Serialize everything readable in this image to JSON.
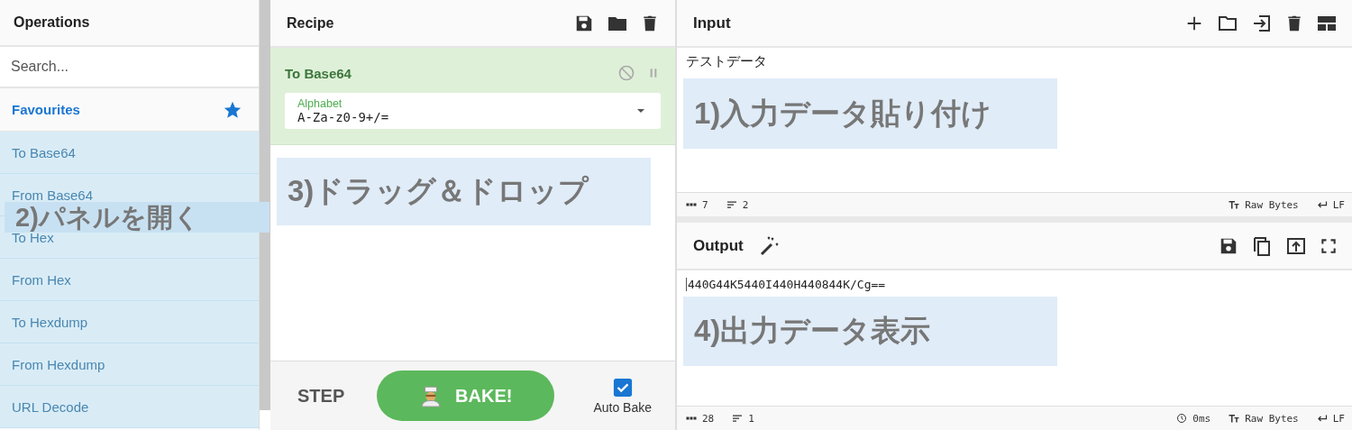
{
  "operations": {
    "title": "Operations",
    "search": {
      "placeholder": "Search..."
    },
    "favourites": {
      "label": "Favourites"
    },
    "items": [
      {
        "label": "To Base64"
      },
      {
        "label": "From Base64"
      },
      {
        "label": "To Hex"
      },
      {
        "label": "From Hex"
      },
      {
        "label": "To Hexdump"
      },
      {
        "label": "From Hexdump"
      },
      {
        "label": "URL Decode"
      }
    ]
  },
  "recipe": {
    "title": "Recipe",
    "operations": [
      {
        "name": "To Base64",
        "args": [
          {
            "label": "Alphabet",
            "value": "A-Za-z0-9+/="
          }
        ]
      }
    ],
    "step": "STEP",
    "bake": "BAKE!",
    "auto_bake": {
      "label": "Auto Bake",
      "checked": true
    }
  },
  "input": {
    "title": "Input",
    "text": "テストデータ",
    "length": "7",
    "lines": "2",
    "encoding": "Raw Bytes",
    "eol": "LF"
  },
  "output": {
    "title": "Output",
    "text": "440G44K5440I440H440844K/Cg==",
    "length": "28",
    "lines": "1",
    "time": "0ms",
    "encoding": "Raw Bytes",
    "eol": "LF"
  },
  "annotations": [
    {
      "text": "1)入力データ貼り付け"
    },
    {
      "text": "2)パネルを開く"
    },
    {
      "text": "3)ドラッグ＆ドロップ"
    },
    {
      "text": "4)出力データ表示"
    }
  ]
}
